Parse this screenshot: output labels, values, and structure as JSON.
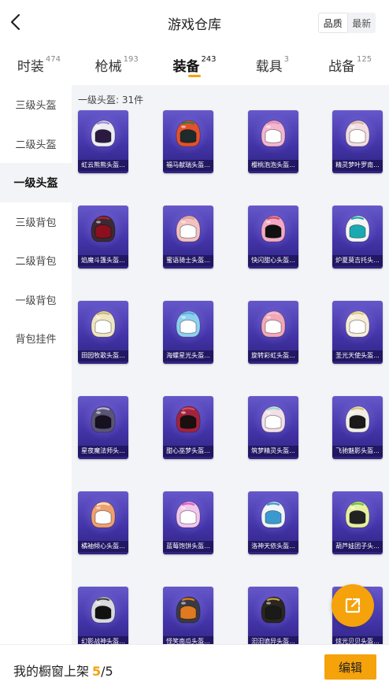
{
  "header": {
    "title": "游戏仓库",
    "back_icon": "chevron-left-icon",
    "sort": {
      "options": [
        "品质",
        "最新"
      ],
      "selected": "品质"
    }
  },
  "tabs": [
    {
      "label": "时装",
      "count": "474",
      "active": false
    },
    {
      "label": "枪械",
      "count": "193",
      "active": false
    },
    {
      "label": "装备",
      "count": "243",
      "active": true
    },
    {
      "label": "载具",
      "count": "3",
      "active": false
    },
    {
      "label": "战备",
      "count": "125",
      "active": false
    }
  ],
  "sidebar": {
    "items": [
      {
        "label": "三级头盔",
        "active": false
      },
      {
        "label": "二级头盔",
        "active": false
      },
      {
        "label": "一级头盔",
        "active": true
      },
      {
        "label": "三级背包",
        "active": false
      },
      {
        "label": "二级背包",
        "active": false
      },
      {
        "label": "一级背包",
        "active": false
      },
      {
        "label": "背包挂件",
        "active": false
      }
    ]
  },
  "content": {
    "section_label": "一级头盔: 31件",
    "items": [
      {
        "name": "虹云熊熊头盔...",
        "shell": "#ececf2",
        "visor": "#2a1a40",
        "accent": "#9f8fd8"
      },
      {
        "name": "福马献瑞头盔...",
        "shell": "#e0522e",
        "visor": "#1f2a2a",
        "accent": "#3a7a3a"
      },
      {
        "name": "樱桃泡泡头盔...",
        "shell": "#f3b6cf",
        "visor": "#ffffff",
        "accent": "#e88fb0"
      },
      {
        "name": "精灵梦叶罗南...",
        "shell": "#f2dde2",
        "visor": "#ffffff",
        "accent": "#d8b7a0"
      },
      {
        "name": "焰魔斗篷头盔...",
        "shell": "#3a2a32",
        "visor": "#8a1020",
        "accent": "#b0203a"
      },
      {
        "name": "蜜语骑士头盔...",
        "shell": "#f3c1bf",
        "visor": "#ffffff",
        "accent": "#e29c9a"
      },
      {
        "name": "快闪甜心头盔...",
        "shell": "#f2a9c3",
        "visor": "#111111",
        "accent": "#d04a6a"
      },
      {
        "name": "炉夏莫吉托头...",
        "shell": "#f4f4f4",
        "visor": "#19a9b0",
        "accent": "#19a9b0"
      },
      {
        "name": "田园牧歌头盔...",
        "shell": "#efe6c2",
        "visor": "#ffffff",
        "accent": "#c9b675"
      },
      {
        "name": "海螺星光头盔...",
        "shell": "#8fd0f0",
        "visor": "#ffffff",
        "accent": "#5aaee0"
      },
      {
        "name": "旋转彩虹头盔...",
        "shell": "#f3a8b8",
        "visor": "#ffffff",
        "accent": "#f0c0d0"
      },
      {
        "name": "圣光天使头盔...",
        "shell": "#f6ecd8",
        "visor": "#ffffff",
        "accent": "#e6c57a"
      },
      {
        "name": "星夜魔法师头...",
        "shell": "#5a5475",
        "visor": "#161020",
        "accent": "#b8b0e0"
      },
      {
        "name": "甜心巫梦头盔...",
        "shell": "#a0243e",
        "visor": "#1a1010",
        "accent": "#d04a6a"
      },
      {
        "name": "筑梦精灵头盔...",
        "shell": "#f3dfe8",
        "visor": "#ffffff",
        "accent": "#8fd8d8"
      },
      {
        "name": "飞驰魅影头盔...",
        "shell": "#f1eee6",
        "visor": "#1a1a1a",
        "accent": "#d6c07a"
      },
      {
        "name": "橘袖倾心头盔...",
        "shell": "#f0a070",
        "visor": "#ffffff",
        "accent": "#f5e6d0"
      },
      {
        "name": "蓝莓饱饼头盔...",
        "shell": "#f2c7ee",
        "visor": "#ffffff",
        "accent": "#e060c0"
      },
      {
        "name": "洛神天依头盔...",
        "shell": "#eef4f8",
        "visor": "#3a9ad0",
        "accent": "#3a9ad0"
      },
      {
        "name": "葫芦娃团子头...",
        "shell": "#e8f0a0",
        "visor": "#222222",
        "accent": "#6ac04a"
      },
      {
        "name": "幻影战神头盔...",
        "shell": "#d8dadf",
        "visor": "#111111",
        "accent": "#444444"
      },
      {
        "name": "怪笑南瓜头盔...",
        "shell": "#3a3a44",
        "visor": "#e07a20",
        "accent": "#e07a20"
      },
      {
        "name": "汩汩诡异头盔...",
        "shell": "#2a2620",
        "visor": "#1a1a1a",
        "accent": "#c6a040"
      },
      {
        "name": "炫光贝贝头盔...",
        "shell": "#f4e8c0",
        "visor": "#ffffff",
        "accent": "#e0c060"
      }
    ]
  },
  "fab": {
    "icon": "share-external-icon"
  },
  "bottom": {
    "showcase_label": "我的橱窗上架",
    "showcase_current": "5",
    "showcase_sep": "/",
    "showcase_total": "5",
    "edit_label": "编辑"
  },
  "colors": {
    "accent": "#f5a20b",
    "card_top": "#6558c9",
    "card_bottom": "#2f2380",
    "content_bg": "#f3f4f7"
  }
}
